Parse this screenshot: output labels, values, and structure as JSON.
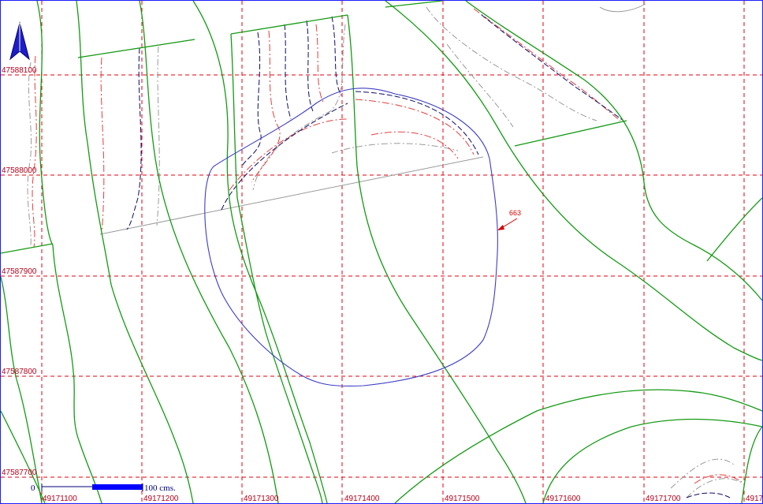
{
  "map": {
    "north_arrow_icon": "north-arrow-icon",
    "colors": {
      "frame": "#1c1cff",
      "grid": "#e3000f",
      "grid_label": "#b3001a",
      "parcel_boundary": "#159a15",
      "contour_blue": "#0b0b66",
      "contour_red": "#e04040",
      "contour_grey": "#9a9a9a",
      "area_outline": "#3e3ec6",
      "annotation": "#d40000",
      "scale_bar": "#0000ff"
    },
    "grid_lines_style": "dashed",
    "x_labels": [
      "49171100",
      "49171200",
      "49171300",
      "49171400",
      "49171500",
      "49171600",
      "49171700",
      "49171"
    ],
    "y_labels": [
      "47588100",
      "47588000",
      "47587900",
      "47587800",
      "47587700"
    ],
    "annotation_label": "663",
    "scale": {
      "zero_label": "0",
      "end_label": "100 cms."
    }
  }
}
